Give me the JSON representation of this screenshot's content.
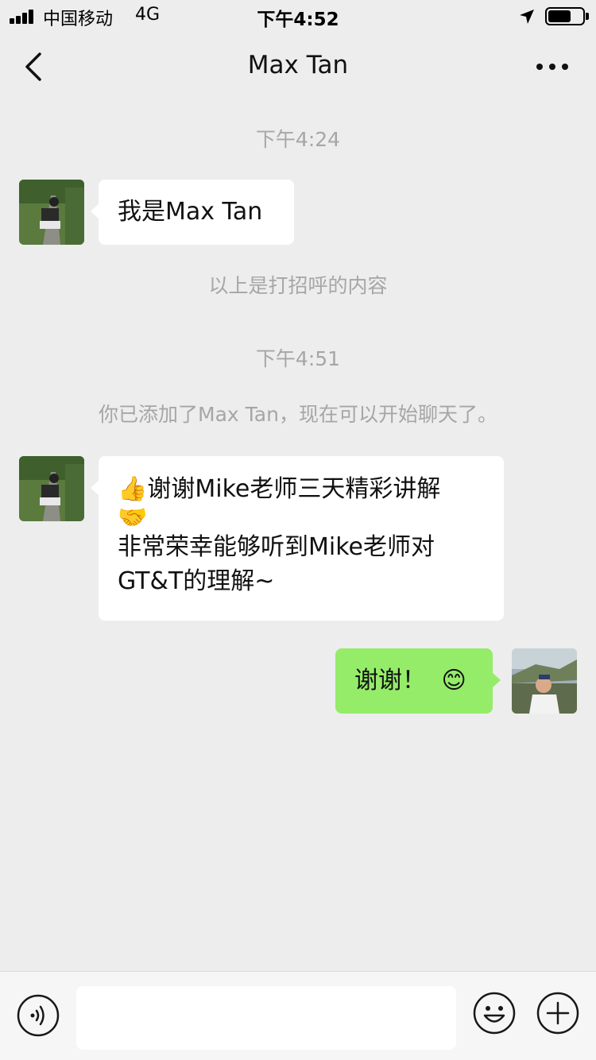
{
  "status_bar": {
    "carrier": "中国移动",
    "network": "4G",
    "time": "下午4:52"
  },
  "nav": {
    "title": "Max Tan",
    "back_icon": "chevron-left-icon",
    "more_icon": "more-horizontal-icon"
  },
  "chat": {
    "time_1": "下午4:24",
    "message_1": "我是Max Tan",
    "system_1": "以上是打招呼的内容",
    "time_2": "下午4:51",
    "system_2": "你已添加了Max Tan，现在可以开始聊天了。",
    "message_2": {
      "emoji_thumbs": "👍",
      "line_1": "谢谢Mike老师三天精彩讲解",
      "emoji_handshake": "🤝",
      "line_2": "非常荣幸能够听到Mike老师对",
      "line_3": "GT&T的理解~"
    },
    "message_3": {
      "text": "谢谢！",
      "emoji": "😊"
    }
  },
  "input_bar": {
    "voice_icon": "voice-icon",
    "emoji_icon": "emoji-icon",
    "plus_icon": "plus-icon",
    "input_value": ""
  },
  "colors": {
    "background": "#ededed",
    "outgoing_bubble": "#95ec69",
    "incoming_bubble": "#ffffff",
    "system_text": "#a6a6a6"
  }
}
